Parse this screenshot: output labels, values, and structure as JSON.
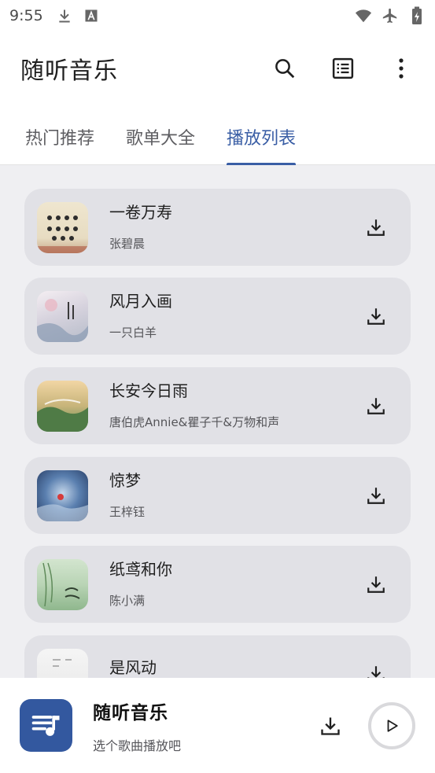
{
  "status_bar": {
    "time": "9:55",
    "icons": [
      "download-icon",
      "a-icon",
      "wifi-icon",
      "airplane-icon",
      "battery-charging-icon"
    ]
  },
  "app_bar": {
    "title": "随听音乐",
    "actions": [
      "search-icon",
      "list-icon",
      "more-vert-icon"
    ]
  },
  "tabs": [
    {
      "label": "热门推荐",
      "active": false
    },
    {
      "label": "歌单大全",
      "active": false
    },
    {
      "label": "播放列表",
      "active": true
    }
  ],
  "colors": {
    "accent": "#3a5ea5",
    "card_bg": "#e1e1e6",
    "list_bg": "#efeff2",
    "player_cover": "#33589f"
  },
  "songs": [
    {
      "title": "一卷万寿",
      "artist": "张碧晨",
      "action_icon": "download-icon"
    },
    {
      "title": "风月入画",
      "artist": "一只白羊",
      "action_icon": "download-icon"
    },
    {
      "title": "长安今日雨",
      "artist": "唐伯虎Annie&瞿子千&万物和声",
      "action_icon": "download-icon"
    },
    {
      "title": "惊梦",
      "artist": "王梓钰",
      "action_icon": "download-icon"
    },
    {
      "title": "纸鸢和你",
      "artist": "陈小满",
      "action_icon": "download-icon"
    },
    {
      "title": "是风动",
      "artist": "",
      "action_icon": "download-icon"
    }
  ],
  "player": {
    "title": "随听音乐",
    "subtitle": "选个歌曲播放吧",
    "cover_icon": "music-queue-icon",
    "download_icon": "download-icon",
    "play_icon": "play-icon"
  }
}
